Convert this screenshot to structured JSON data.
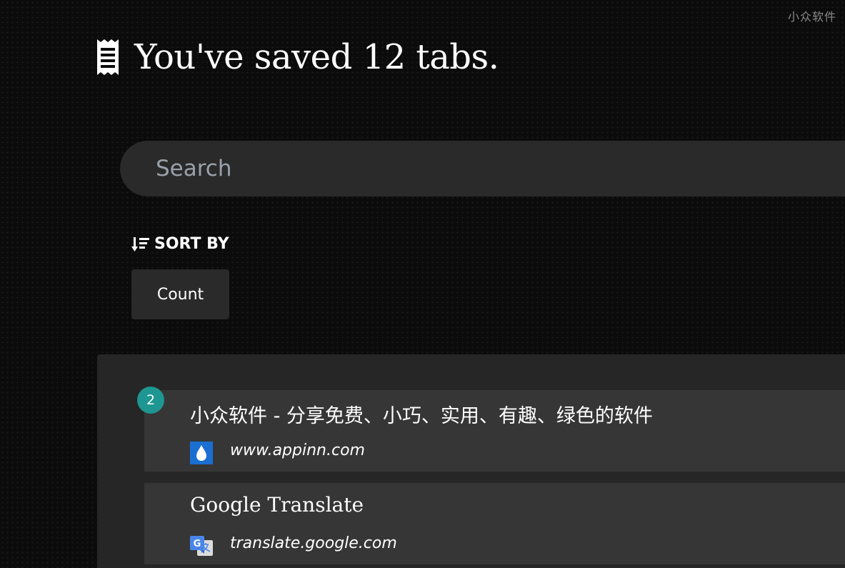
{
  "watermark": "小众软件",
  "header": {
    "title": "You've saved 12 tabs.",
    "icon": "receipt-icon"
  },
  "search": {
    "placeholder": "Search",
    "value": ""
  },
  "sort": {
    "label": "SORT BY",
    "icon": "sort-descending-icon",
    "option_label": "Count"
  },
  "tabs": [
    {
      "title": "小众软件 - 分享免费、小巧、实用、有趣、绿色的软件",
      "url": "www.appinn.com",
      "favicon": "appinn-droplet-icon",
      "count": "2"
    },
    {
      "title": "Google Translate",
      "url": "translate.google.com",
      "favicon": "google-translate-icon",
      "count": ""
    }
  ],
  "colors": {
    "background": "#0b0b0b",
    "surface": "#2a2a2a",
    "panel": "#262626",
    "item": "#363636",
    "badge": "#1e9692",
    "appinn_blue": "#1a6fd1",
    "google_blue": "#4a86e8"
  }
}
